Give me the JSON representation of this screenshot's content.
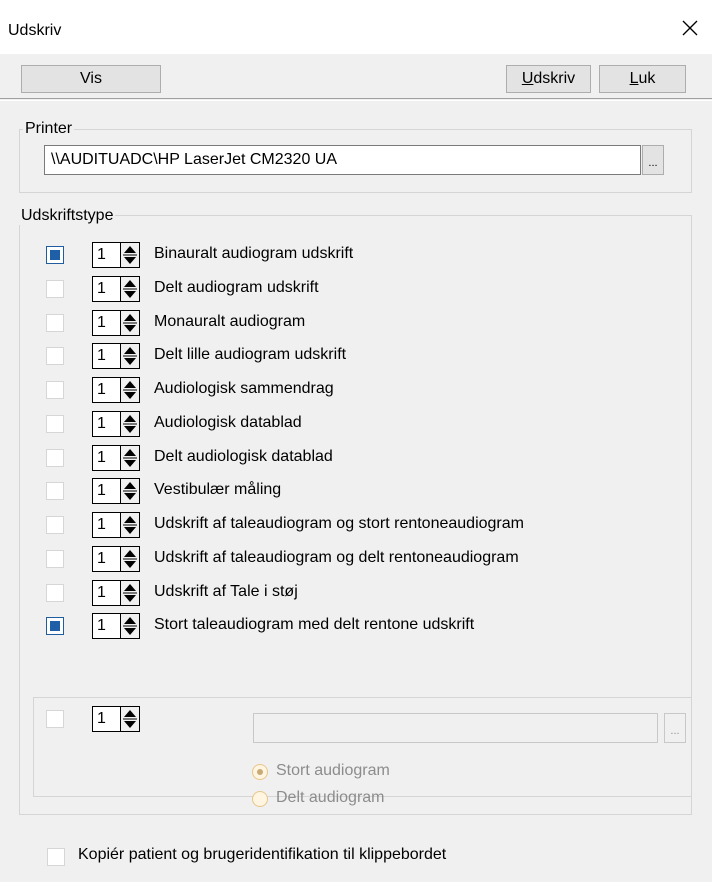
{
  "window": {
    "title": "Udskriv",
    "close_icon": "close-icon"
  },
  "toolbar": {
    "vis_label": "Vis",
    "udskriv_label_accel": "U",
    "udskriv_label_rest": "dskriv",
    "luk_label_accel": "L",
    "luk_label_rest": "uk"
  },
  "printer": {
    "legend": "Printer",
    "value": "\\\\AUDITUADC\\HP LaserJet CM2320 UA",
    "browse_label": "..."
  },
  "print_types": {
    "legend": "Udskriftstype",
    "items": [
      {
        "checked": true,
        "count": "1",
        "label": "Binauralt audiogram udskrift"
      },
      {
        "checked": false,
        "count": "1",
        "label": "Delt audiogram udskrift"
      },
      {
        "checked": false,
        "count": "1",
        "label": "Monauralt audiogram"
      },
      {
        "checked": false,
        "count": "1",
        "label": "Delt lille audiogram udskrift"
      },
      {
        "checked": false,
        "count": "1",
        "label": "Audiologisk sammendrag"
      },
      {
        "checked": false,
        "count": "1",
        "label": "Audiologisk datablad"
      },
      {
        "checked": false,
        "count": "1",
        "label": "Delt audiologisk datablad"
      },
      {
        "checked": false,
        "count": "1",
        "label": "Vestibulær måling"
      },
      {
        "checked": false,
        "count": "1",
        "label": "Udskrift af taleaudiogram og stort rentoneaudiogram"
      },
      {
        "checked": false,
        "count": "1",
        "label": "Udskrift af taleaudiogram og delt rentoneaudiogram"
      },
      {
        "checked": false,
        "count": "1",
        "label": "Udskrift af Tale i støj"
      },
      {
        "checked": true,
        "count": "1",
        "label": "Stort taleaudiogram med delt rentone udskrift"
      }
    ]
  },
  "custom": {
    "checked": false,
    "count": "1",
    "path_value": "",
    "browse_label": "...",
    "radio_options": [
      {
        "label": "Stort audiogram",
        "selected": true
      },
      {
        "label": "Delt audiogram",
        "selected": false
      }
    ]
  },
  "clipboard_option": {
    "checked": false,
    "label": "Kopiér patient og brugeridentifikation til klippebordet"
  },
  "colors": {
    "accent": "#1e5fa8",
    "background": "#f0f0f0",
    "button": "#e3e3e3"
  }
}
